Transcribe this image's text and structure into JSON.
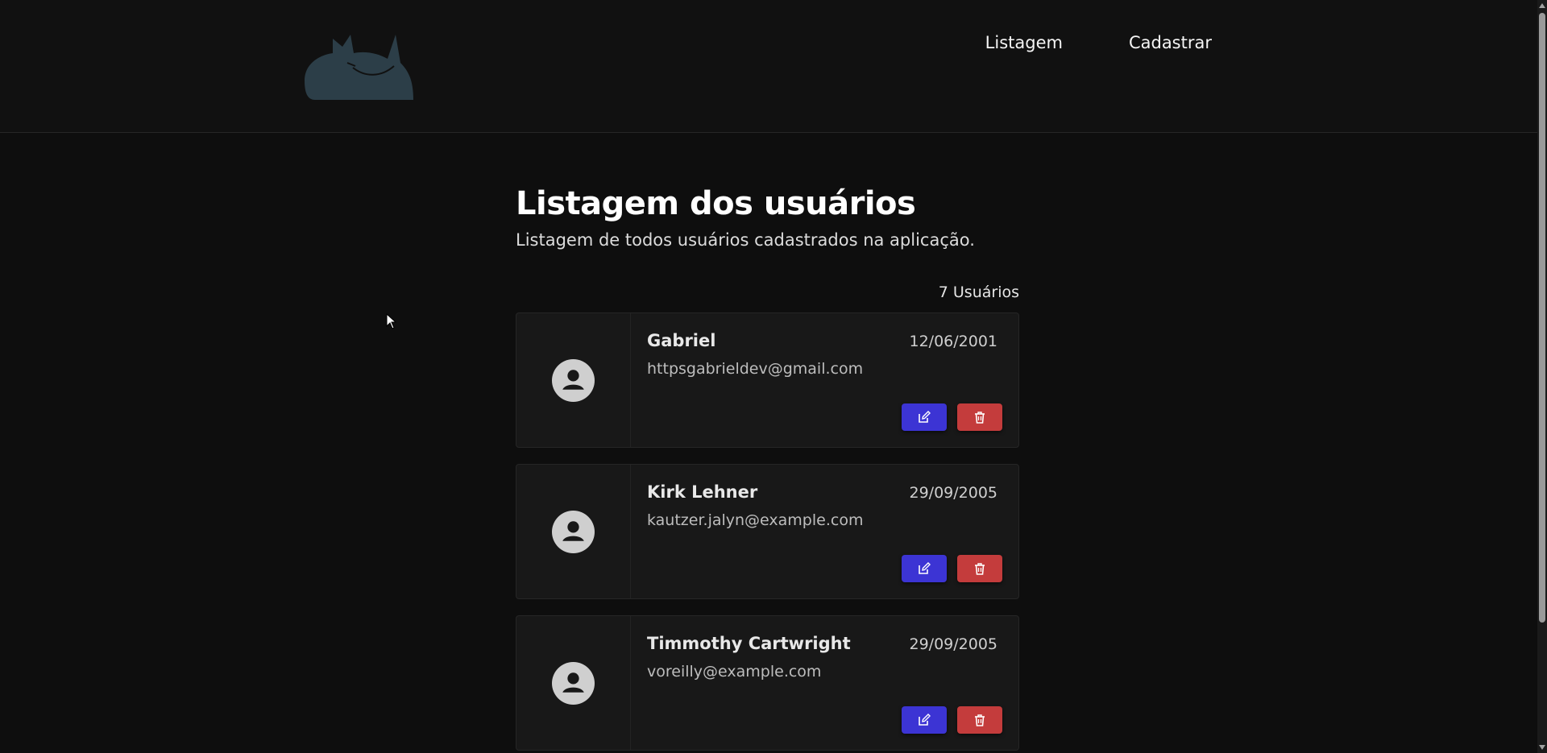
{
  "nav": {
    "items": [
      {
        "label": "Listagem"
      },
      {
        "label": "Cadastrar"
      }
    ]
  },
  "main": {
    "title": "Listagem dos usuários",
    "subtitle": "Listagem de todos usuários cadastrados na aplicação.",
    "count_label": "7 Usuários"
  },
  "users": [
    {
      "name": "Gabriel",
      "date": "12/06/2001",
      "email": "httpsgabrieldev@gmail.com"
    },
    {
      "name": "Kirk Lehner",
      "date": "29/09/2005",
      "email": "kautzer.jalyn@example.com"
    },
    {
      "name": "Timmothy Cartwright",
      "date": "29/09/2005",
      "email": "voreilly@example.com"
    }
  ],
  "colors": {
    "background": "#0e0e0e",
    "header": "#111111",
    "card": "#181818",
    "edit_button": "#3c34d4",
    "delete_button": "#c43c3c",
    "logo": "#2c3e48"
  },
  "icons": {
    "logo": "cat-logo-icon",
    "avatar": "user-circle-icon",
    "edit": "edit-icon",
    "delete": "trash-icon"
  }
}
